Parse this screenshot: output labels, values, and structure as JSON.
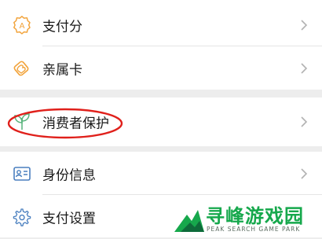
{
  "menu": {
    "group1": [
      {
        "label": "支付分",
        "icon": "payscore-badge-icon"
      },
      {
        "label": "亲属卡",
        "icon": "family-card-icon"
      }
    ],
    "group2": [
      {
        "label": "消费者保护",
        "icon": "leaf-shield-icon"
      }
    ],
    "group3": [
      {
        "label": "身份信息",
        "icon": "id-card-icon"
      },
      {
        "label": "支付设置",
        "icon": "gear-icon"
      }
    ]
  },
  "watermark": {
    "title": "寻峰游戏园",
    "subtitle": "PEAK SEARCH GAME PARK"
  },
  "colors": {
    "accent_orange": "#f2a33a",
    "accent_green": "#57b37a",
    "accent_blue": "#4a7fbf",
    "annotation_red": "#e0201b",
    "watermark_green": "#16a84c"
  }
}
